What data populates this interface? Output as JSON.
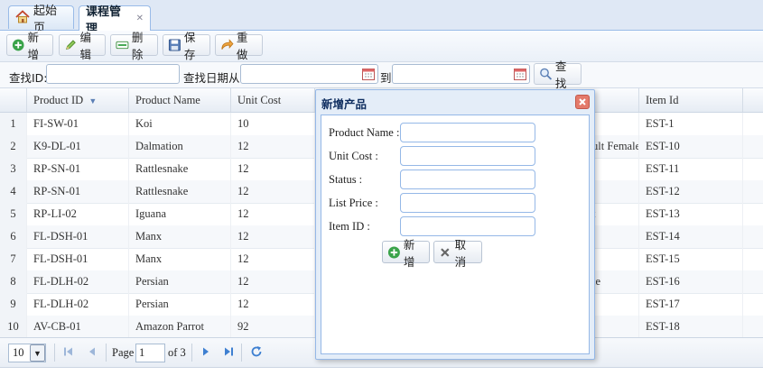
{
  "tabs": [
    {
      "label": "起始页",
      "icon": "home-icon"
    },
    {
      "label": "课程管理",
      "closable": true
    }
  ],
  "toolbar": {
    "add": "新增",
    "edit": "编辑",
    "delete": "删除",
    "save": "保存",
    "redo": "重做"
  },
  "search": {
    "id_label": "查找ID:",
    "date_from_label": "查找日期从",
    "to_label": "到",
    "search_button": "查找"
  },
  "grid": {
    "columns": [
      "Product ID",
      "Product Name",
      "Unit Cost",
      "Item Id"
    ],
    "rows": [
      {
        "n": "1",
        "pid": "FI-SW-01",
        "name": "Koi",
        "cost": "10",
        "attr": "",
        "item": "EST-1"
      },
      {
        "n": "2",
        "pid": "K9-DL-01",
        "name": "Dalmation",
        "cost": "12",
        "attr": "ult Female",
        "item": "EST-10"
      },
      {
        "n": "3",
        "pid": "RP-SN-01",
        "name": "Rattlesnake",
        "cost": "12",
        "attr": "",
        "item": "EST-11"
      },
      {
        "n": "4",
        "pid": "RP-SN-01",
        "name": "Rattlesnake",
        "cost": "12",
        "attr": "",
        "item": "EST-12"
      },
      {
        "n": "5",
        "pid": "RP-LI-02",
        "name": "Iguana",
        "cost": "12",
        "attr": "t",
        "item": "EST-13"
      },
      {
        "n": "6",
        "pid": "FL-DSH-01",
        "name": "Manx",
        "cost": "12",
        "attr": "",
        "item": "EST-14"
      },
      {
        "n": "7",
        "pid": "FL-DSH-01",
        "name": "Manx",
        "cost": "12",
        "attr": "",
        "item": "EST-15"
      },
      {
        "n": "8",
        "pid": "FL-DLH-02",
        "name": "Persian",
        "cost": "12",
        "attr": "le",
        "item": "EST-16"
      },
      {
        "n": "9",
        "pid": "FL-DLH-02",
        "name": "Persian",
        "cost": "12",
        "attr": "",
        "item": "EST-17"
      },
      {
        "n": "10",
        "pid": "AV-CB-01",
        "name": "Amazon Parrot",
        "cost": "92",
        "attr": "",
        "item": "EST-18"
      }
    ]
  },
  "pager": {
    "page_size": "10",
    "page_label": "Page",
    "page_value": "1",
    "of_label": "of 3"
  },
  "dialog": {
    "title": "新增产品",
    "fields": [
      "Product Name :",
      "Unit Cost :",
      "Status :",
      "List Price :",
      "Item ID :"
    ],
    "add_button": "新增",
    "cancel_button": "取消"
  },
  "colors": {
    "accent": "#95b8e7",
    "add_green": "#3aa34a",
    "close_red": "#e47a6a"
  }
}
